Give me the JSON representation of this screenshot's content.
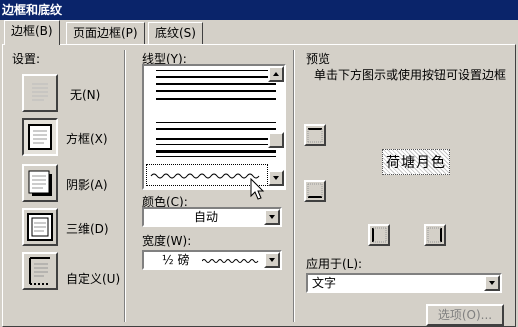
{
  "window": {
    "title": "边框和底纹"
  },
  "tabs": [
    {
      "label": "边框(B)"
    },
    {
      "label": "页面边框(P)"
    },
    {
      "label": "底纹(S)"
    }
  ],
  "settings": {
    "label": "设置:",
    "items": [
      {
        "label": "无(N)"
      },
      {
        "label": "方框(X)"
      },
      {
        "label": "阴影(A)"
      },
      {
        "label": "三维(D)"
      },
      {
        "label": "自定义(U)"
      }
    ]
  },
  "line_style": {
    "label": "线型(Y):"
  },
  "color": {
    "label": "颜色(C):",
    "value": "自动"
  },
  "width": {
    "label": "宽度(W):",
    "value": "½ 磅"
  },
  "preview": {
    "label": "预览",
    "hint": "单击下方图示或使用按钮可设置边框",
    "sample_text": "荷塘月色"
  },
  "apply_to": {
    "label": "应用于(L):",
    "value": "文字"
  },
  "options_button": {
    "label": "选项(O)..."
  }
}
